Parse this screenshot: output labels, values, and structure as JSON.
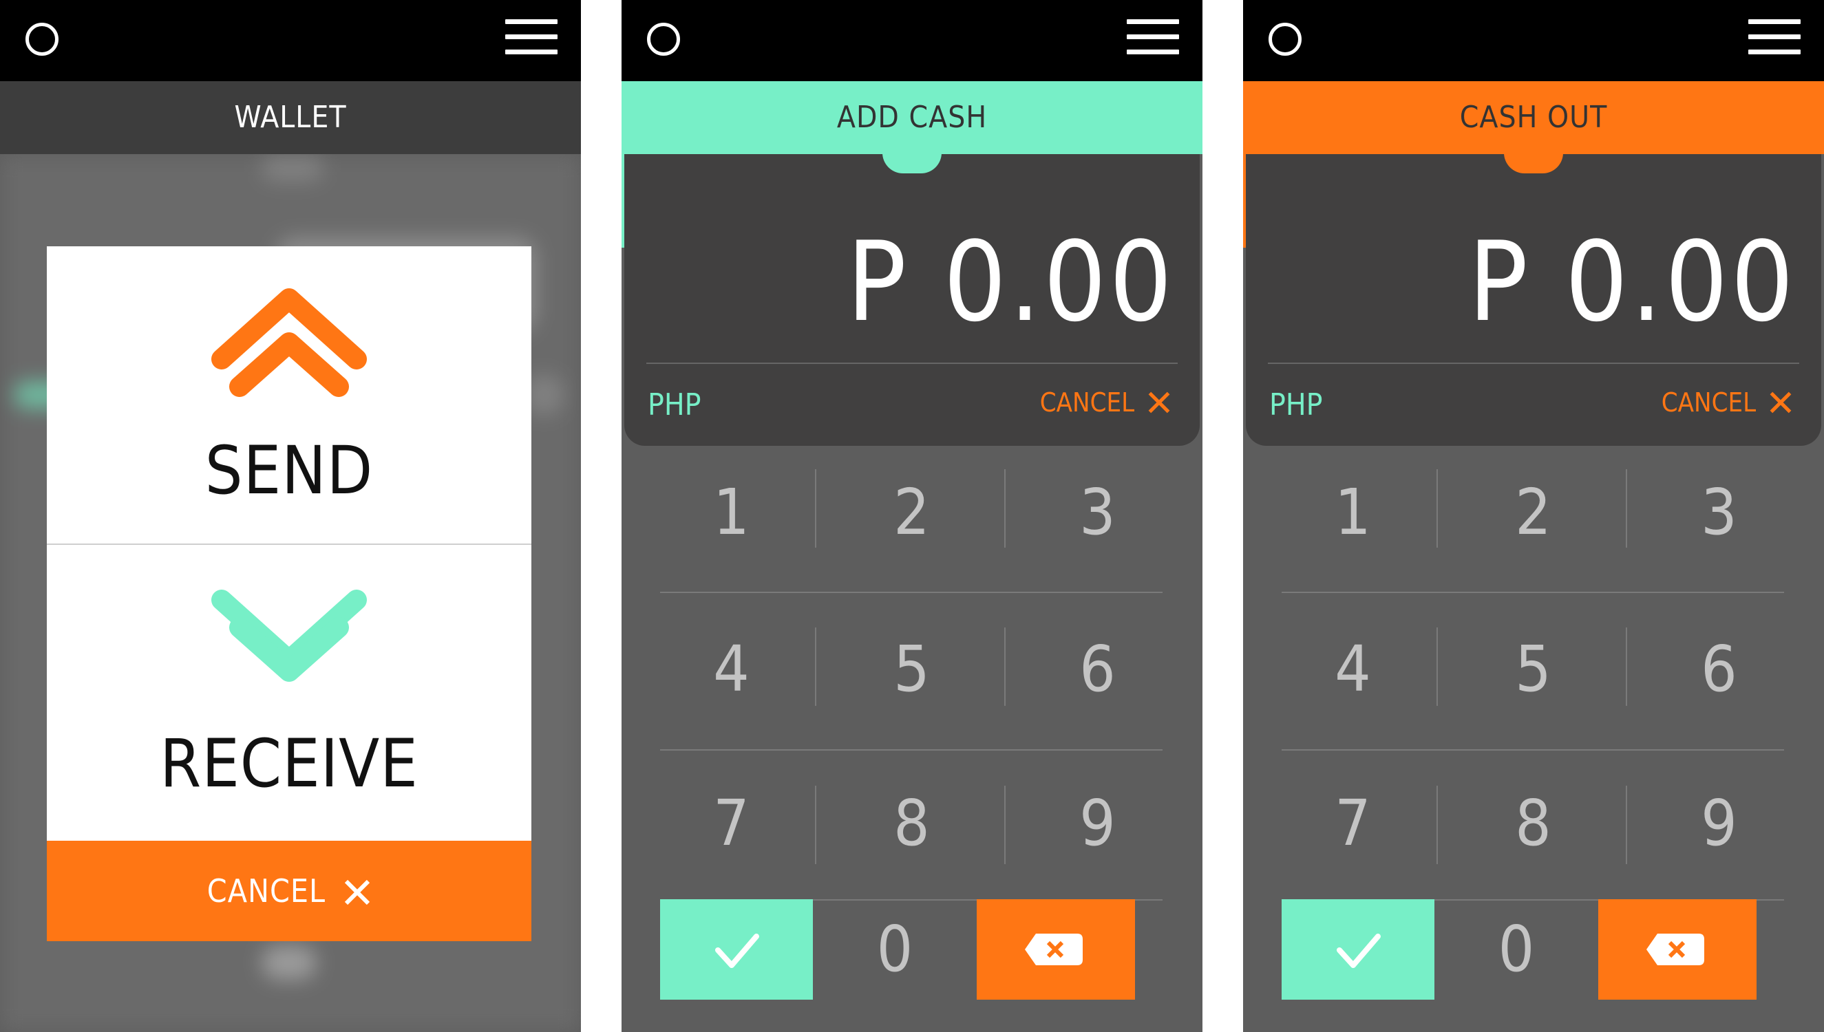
{
  "colors": {
    "accent_green": "#77efc7",
    "accent_orange": "#ff7614",
    "dark": "#414040",
    "panel": "#5d5d5d"
  },
  "icons": {
    "status_left": "circle-icon",
    "status_right": "menu-icon",
    "send": "double-chevron-up-icon",
    "receive": "double-chevron-down-icon",
    "cancel": "close-icon",
    "confirm": "check-icon",
    "backspace": "backspace-icon"
  },
  "wallet": {
    "title": "WALLET",
    "send_label": "SEND",
    "receive_label": "RECEIVE",
    "cancel_label": "CANCEL"
  },
  "add_cash": {
    "title": "ADD CASH",
    "amount": "P 0.00",
    "currency": "PHP",
    "cancel_label": "CANCEL",
    "keys": [
      "1",
      "2",
      "3",
      "4",
      "5",
      "6",
      "7",
      "8",
      "9"
    ],
    "zero": "0"
  },
  "cash_out": {
    "title": "CASH OUT",
    "amount": "P 0.00",
    "currency": "PHP",
    "cancel_label": "CANCEL",
    "keys": [
      "1",
      "2",
      "3",
      "4",
      "5",
      "6",
      "7",
      "8",
      "9"
    ],
    "zero": "0"
  }
}
